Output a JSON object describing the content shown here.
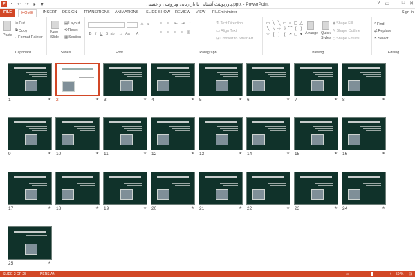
{
  "titlebar": {
    "title": "پاورپوینت آشنایی با بازاریابی ویروسی و عصبی.pptx - PowerPoint",
    "app_icon": "P",
    "qat": [
      "save-icon",
      "undo-icon",
      "redo-icon",
      "present-icon",
      "customize-icon"
    ],
    "window_controls": [
      "?",
      "▭",
      "–",
      "□",
      "✕"
    ]
  },
  "tabs": [
    {
      "label": "FILE",
      "kind": "file"
    },
    {
      "label": "HOME",
      "kind": "active"
    },
    {
      "label": "INSERT"
    },
    {
      "label": "DESIGN"
    },
    {
      "label": "TRANSITIONS"
    },
    {
      "label": "ANIMATIONS"
    },
    {
      "label": "SLIDE SHOW"
    },
    {
      "label": "REVIEW"
    },
    {
      "label": "VIEW"
    },
    {
      "label": "FILEminimizer"
    }
  ],
  "signin": "Sign in",
  "ribbon": {
    "clipboard": {
      "label": "Clipboard",
      "paste": "Paste",
      "cut": "Cut",
      "copy": "Copy",
      "format_painter": "Format Painter"
    },
    "slides": {
      "label": "Slides",
      "new_slide_line1": "New",
      "new_slide_line2": "Slide",
      "layout": "Layout",
      "reset": "Reset",
      "section": "Section"
    },
    "font": {
      "label": "Font"
    },
    "paragraph": {
      "label": "Paragraph",
      "text_direction": "Text Direction",
      "align_text": "Align Text",
      "convert_smartart": "Convert to SmartArt"
    },
    "drawing": {
      "label": "Drawing",
      "arrange": "Arrange",
      "quick_styles_line1": "Quick",
      "quick_styles_line2": "Styles",
      "shape_fill": "Shape Fill",
      "shape_outline": "Shape Outline",
      "shape_effects": "Shape Effects"
    },
    "editing": {
      "label": "Editing",
      "find": "Find",
      "replace": "Replace",
      "select": "Select"
    }
  },
  "slides": [
    {
      "n": "1"
    },
    {
      "n": "2",
      "selected": true
    },
    {
      "n": "3"
    },
    {
      "n": "4"
    },
    {
      "n": "5"
    },
    {
      "n": "6"
    },
    {
      "n": "7"
    },
    {
      "n": "8"
    },
    {
      "n": "9"
    },
    {
      "n": "10"
    },
    {
      "n": "11"
    },
    {
      "n": "12"
    },
    {
      "n": "13"
    },
    {
      "n": "14"
    },
    {
      "n": "15"
    },
    {
      "n": "16"
    },
    {
      "n": "17"
    },
    {
      "n": "18"
    },
    {
      "n": "19"
    },
    {
      "n": "20"
    },
    {
      "n": "21"
    },
    {
      "n": "22"
    },
    {
      "n": "23"
    },
    {
      "n": "24"
    },
    {
      "n": "25"
    }
  ],
  "slide_star": "★",
  "statusbar": {
    "slide_info": "SLIDE 2 OF 25",
    "language": "PERSIAN",
    "zoom": "50 %"
  },
  "colors": {
    "accent": "#d24726",
    "thumb_bg": "#10322a"
  }
}
